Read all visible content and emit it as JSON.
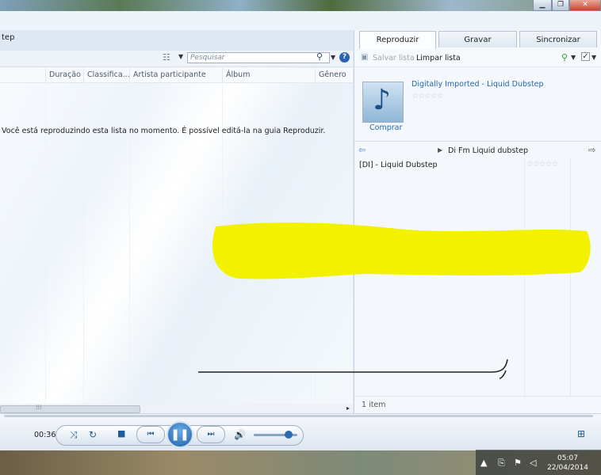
{
  "window": {
    "library_title": "tep"
  },
  "search": {
    "placeholder": "Pesquisar"
  },
  "columns": [
    "Duração",
    "Classifica...",
    "Artista participante",
    "Álbum",
    "Gênero"
  ],
  "list_message": "Você está reproduzindo esta lista no momento. É possível editá-la na guia Reproduzir.",
  "tabs": {
    "play": "Reproduzir",
    "burn": "Gravar",
    "sync": "Sincronizar"
  },
  "right_toolbar": {
    "save_list": "Salvar lista",
    "clear_list": "Limpar lista"
  },
  "now_playing": {
    "title": "Digitally Imported - Liquid Dubstep",
    "buy": "Comprar"
  },
  "playlist": {
    "name": "Di Fm Liquid dubstep",
    "items": [
      {
        "title": "[DI] - Liquid Dubstep"
      }
    ],
    "count": "1 item"
  },
  "player": {
    "time": "00:36",
    "volume_level": 0.8
  },
  "taskbar": {
    "time": "05:07",
    "date": "22/04/2014"
  },
  "icons": {
    "music_note": "music-note-icon",
    "star": "rating-star-icon",
    "play": "play-icon",
    "pause": "pause-icon"
  },
  "colors": {
    "highlight": "#f2f200",
    "accent": "#1f5fa8"
  }
}
